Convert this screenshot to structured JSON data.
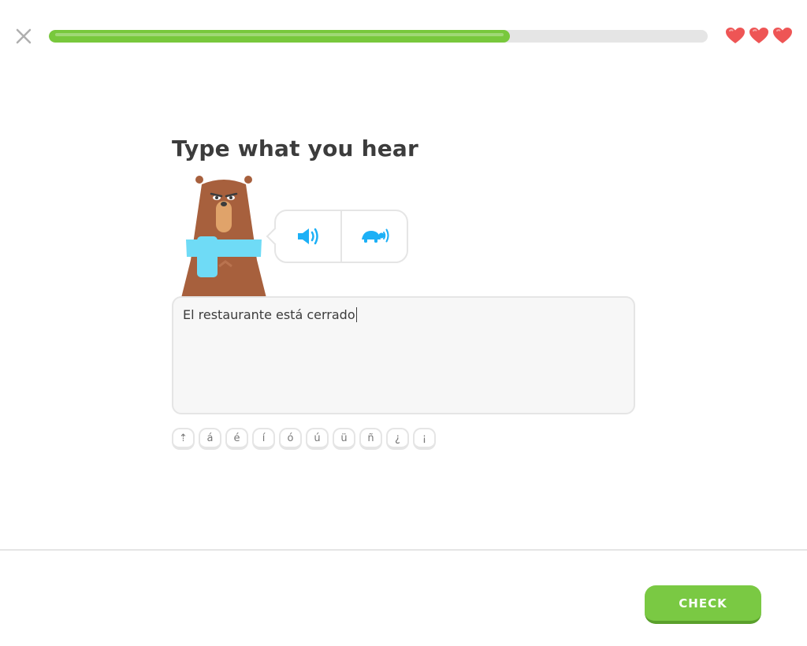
{
  "header": {
    "close_icon": "close-icon",
    "progress": 0.7,
    "progress_color": "#78c83c",
    "hearts": {
      "count": 3,
      "color": "#ee5555",
      "icon": "heart-icon"
    }
  },
  "challenge": {
    "title": "Type what you hear",
    "character": "bear",
    "audio_buttons": [
      {
        "name": "play-audio",
        "icon": "speaker-icon"
      },
      {
        "name": "play-slow-audio",
        "icon": "turtle-icon"
      }
    ],
    "answer_value": "El restaurante está cerrado",
    "special_keys": [
      "⇡",
      "á",
      "é",
      "í",
      "ó",
      "ú",
      "ü",
      "ñ",
      "¿",
      "¡"
    ]
  },
  "footer": {
    "check_label": "CHECK",
    "check_color": "#7ac943"
  }
}
